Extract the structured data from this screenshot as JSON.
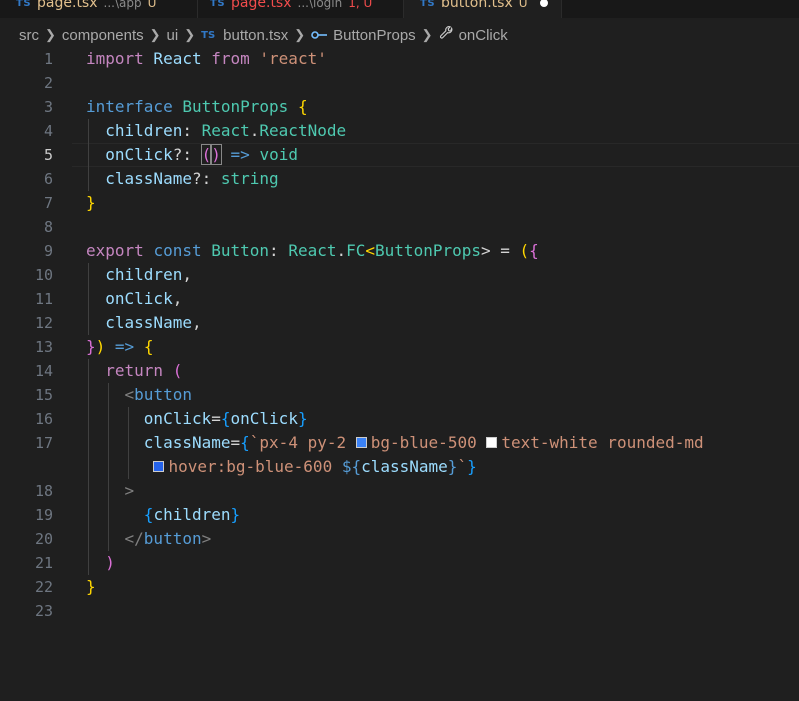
{
  "tabs": [
    {
      "name": "page.tsx",
      "path": "...\\app",
      "badge": "U",
      "lang": "TS",
      "error": false,
      "active": false
    },
    {
      "name": "page.tsx",
      "path": "...\\login",
      "badge": "1, U",
      "lang": "TS",
      "error": true,
      "active": false
    },
    {
      "name": "button.tsx",
      "path": "",
      "badge": "U",
      "lang": "TS",
      "error": false,
      "active": true
    }
  ],
  "breadcrumb": {
    "items": [
      "src",
      "components",
      "ui"
    ],
    "file_lang": "TS",
    "file": "button.tsx",
    "symbol": "ButtonProps",
    "member": "onClick"
  },
  "editor": {
    "current_line": 5,
    "line_numbers": [
      "1",
      "2",
      "3",
      "4",
      "5",
      "6",
      "7",
      "8",
      "9",
      "10",
      "11",
      "12",
      "13",
      "14",
      "15",
      "16",
      "17",
      "18",
      "19",
      "20",
      "21",
      "22",
      "23"
    ],
    "code": {
      "l1": [
        "import",
        " React ",
        "from",
        " ",
        "'react'"
      ],
      "l3": [
        "interface",
        " ",
        "ButtonProps",
        " ",
        "{"
      ],
      "l4": [
        "children",
        ": ",
        "React",
        ".",
        "ReactNode"
      ],
      "l5": [
        "onClick",
        "?: ",
        "(",
        ")",
        " ",
        "=>",
        " ",
        "void"
      ],
      "l6": [
        "className",
        "?: ",
        "string"
      ],
      "l7": [
        "}"
      ],
      "l9": [
        "export",
        " ",
        "const",
        " ",
        "Button",
        ": ",
        "React",
        ".",
        "FC",
        "<",
        "ButtonProps",
        "> = ",
        "(",
        "{"
      ],
      "l10": [
        "children",
        ","
      ],
      "l11": [
        "onClick",
        ","
      ],
      "l12": [
        "className",
        ","
      ],
      "l13": [
        "}",
        ")",
        " ",
        "=>",
        " ",
        "{"
      ],
      "l14": [
        "return",
        " ",
        "("
      ],
      "l15": [
        "<",
        "button"
      ],
      "l16": [
        "onClick",
        "=",
        "{",
        "onClick",
        "}"
      ],
      "l17": [
        "className",
        "=",
        "{",
        "`px-4 py-2 ",
        "bg-blue-500 ",
        "text-white rounded-md"
      ],
      "l17b": [
        "hover:bg-blue-600 ",
        "${",
        "className",
        "}",
        "`",
        "}"
      ],
      "l18": [
        ">"
      ],
      "l19": [
        "{",
        "children",
        "}"
      ],
      "l20": [
        "</",
        "button",
        ">"
      ],
      "l21": [
        ")"
      ],
      "l22": [
        "}"
      ]
    },
    "swatches": {
      "blue500": "#3b82f6",
      "white": "#ffffff",
      "blue600": "#2563eb"
    }
  }
}
